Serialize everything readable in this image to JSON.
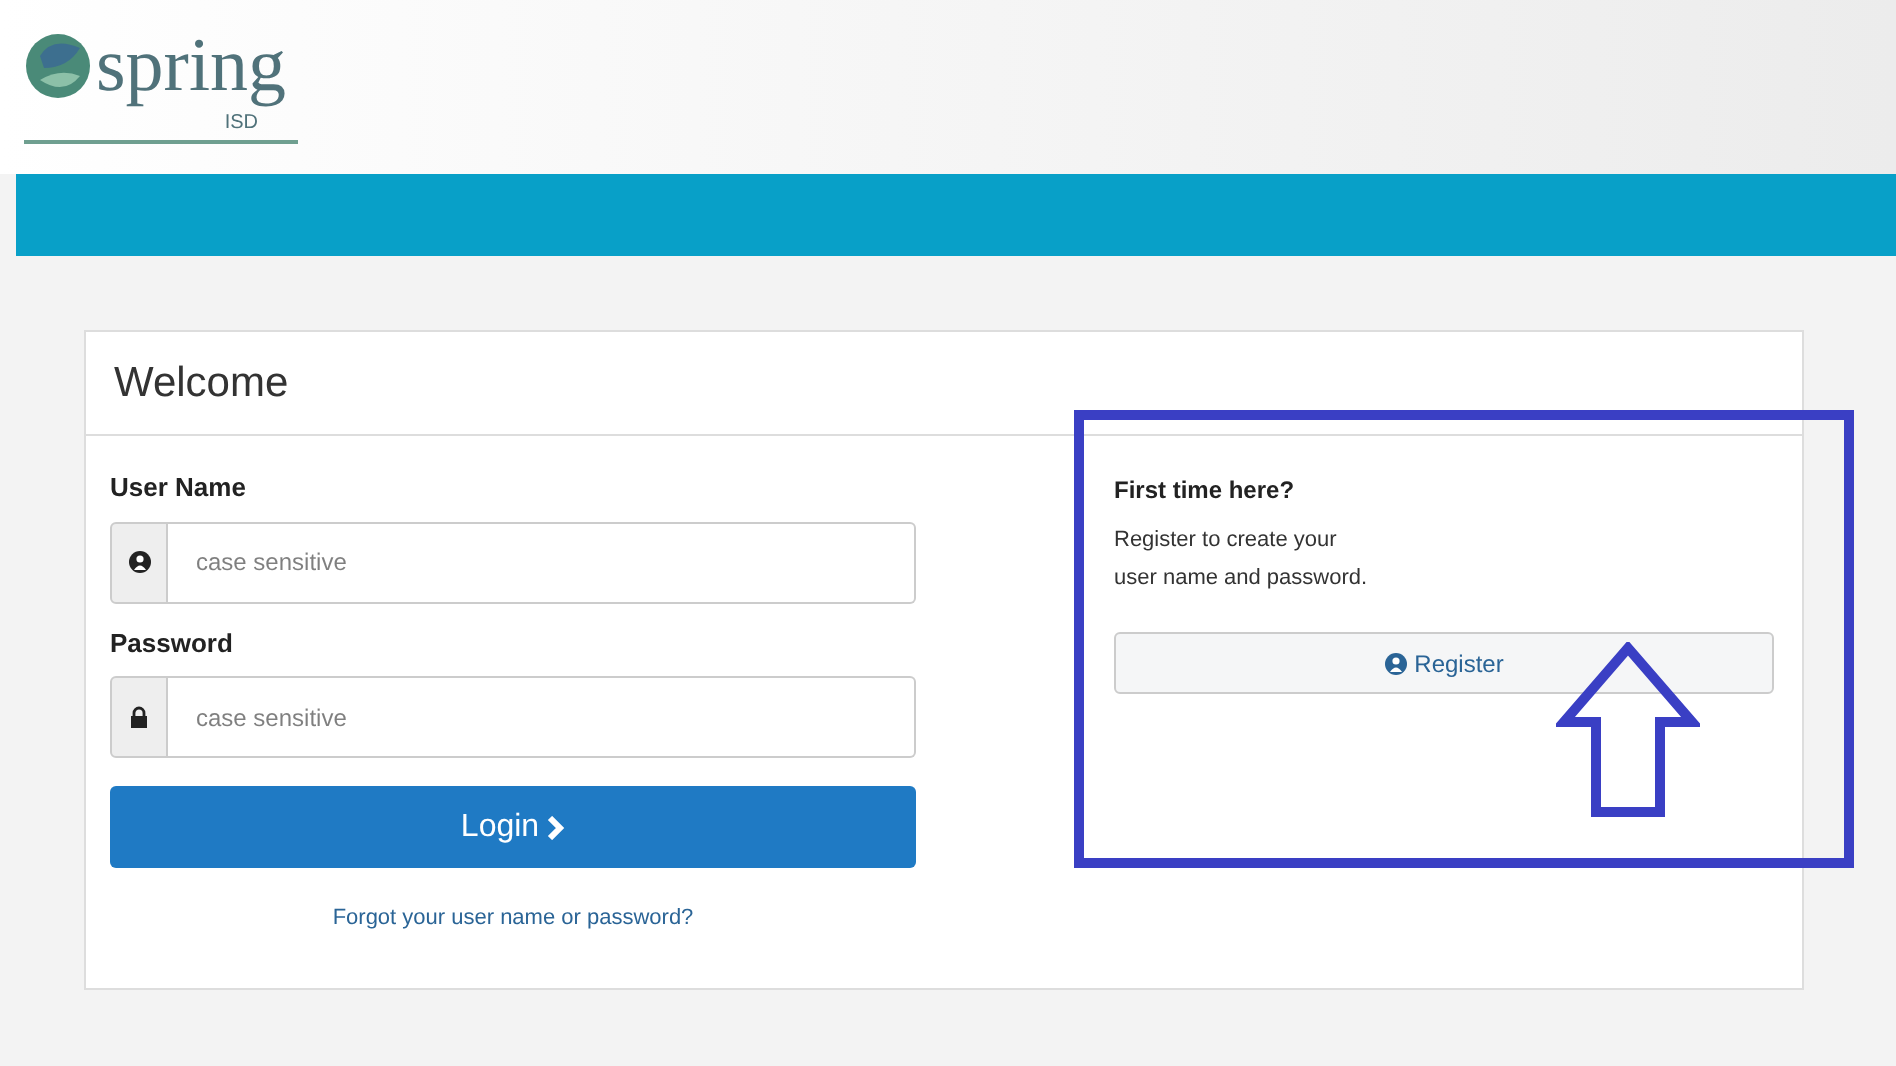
{
  "logo": {
    "name": "spring",
    "sub": "ISD"
  },
  "card": {
    "title": "Welcome",
    "fields": [
      {
        "label": "User Name",
        "kind": "user",
        "placeholder": "case sensitive"
      },
      {
        "label": "Password",
        "kind": "password",
        "placeholder": "case sensitive"
      }
    ],
    "login_button": "Login",
    "forgot_link": "Forgot your user name or password?",
    "register": {
      "heading": "First time here?",
      "lines": [
        "Register to create your",
        "user name and password."
      ],
      "button": "Register"
    }
  }
}
